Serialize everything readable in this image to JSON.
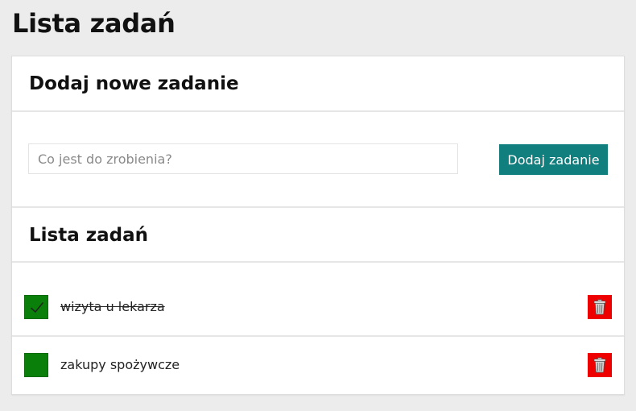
{
  "page": {
    "title": "Lista zadań"
  },
  "add_section": {
    "heading": "Dodaj nowe zadanie",
    "input_placeholder": "Co jest do zrobienia?",
    "input_value": "",
    "button_label": "Dodaj zadanie"
  },
  "list_section": {
    "heading": "Lista zadań",
    "tasks": [
      {
        "text": "wizyta u lekarza",
        "done": true
      },
      {
        "text": "zakupy spożywcze",
        "done": false
      }
    ]
  },
  "icons": {
    "check": "check-icon",
    "delete": "trash-icon"
  },
  "colors": {
    "accent": "#127f7f",
    "checkbox": "#0a7f0a",
    "delete": "#ee0000",
    "background": "#ececec"
  }
}
